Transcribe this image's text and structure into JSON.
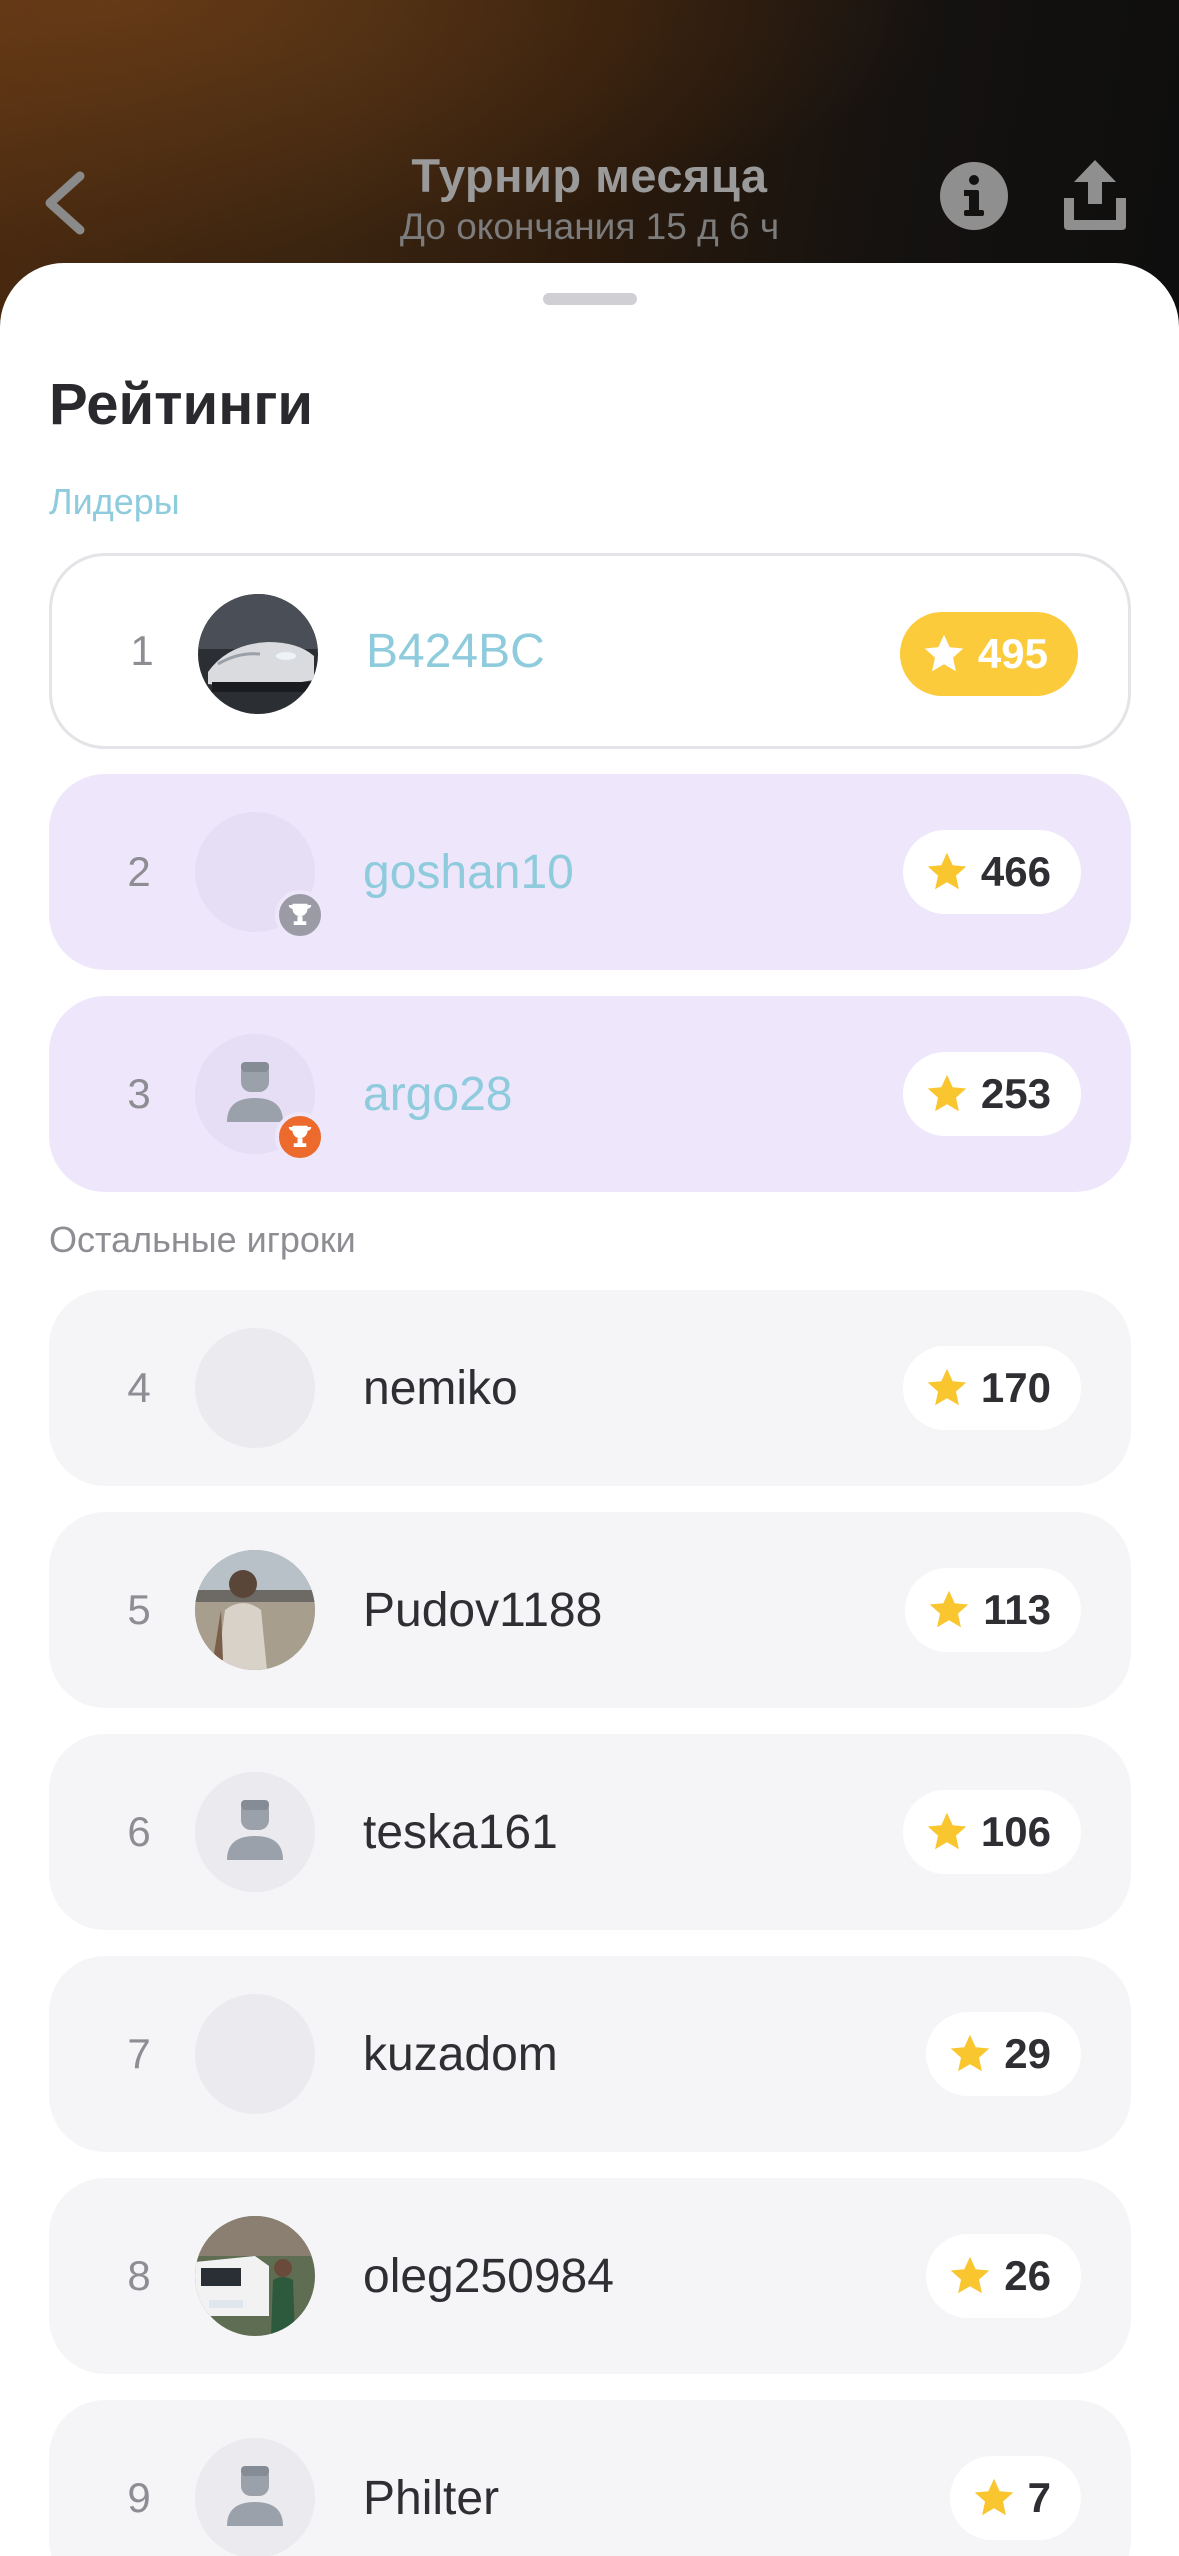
{
  "header": {
    "title": "Турнир месяца",
    "subtitle": "До окончания 15 д 6 ч",
    "back_icon": "chevron-left-icon",
    "info_icon": "info-icon",
    "share_icon": "share-icon"
  },
  "sheet": {
    "title": "Рейтинги",
    "leaders_label": "Лидеры",
    "others_label": "Остальные игроки"
  },
  "colors": {
    "accent": "#8ecbdc",
    "gold": "#fbcb3c",
    "leader_bg": "#eee6fb",
    "row_bg": "#f5f5f7"
  },
  "leaders": [
    {
      "rank": "1",
      "name": "B424BC",
      "score": "495",
      "avatar": "car-photo"
    },
    {
      "rank": "2",
      "name": "goshan10",
      "score": "466",
      "avatar": "empty",
      "medal": "silver-trophy-icon"
    },
    {
      "rank": "3",
      "name": "argo28",
      "score": "253",
      "avatar": "person-icon",
      "medal": "bronze-trophy-icon"
    }
  ],
  "players": [
    {
      "rank": "4",
      "name": "nemiko",
      "score": "170",
      "avatar": "empty"
    },
    {
      "rank": "5",
      "name": "Pudov1188",
      "score": "113",
      "avatar": "beach-photo"
    },
    {
      "rank": "6",
      "name": "teska161",
      "score": "106",
      "avatar": "person-icon"
    },
    {
      "rank": "7",
      "name": "kuzadom",
      "score": "29",
      "avatar": "empty"
    },
    {
      "rank": "8",
      "name": "oleg250984",
      "score": "26",
      "avatar": "van-photo"
    },
    {
      "rank": "9",
      "name": "Philter",
      "score": "7",
      "avatar": "person-icon"
    }
  ]
}
